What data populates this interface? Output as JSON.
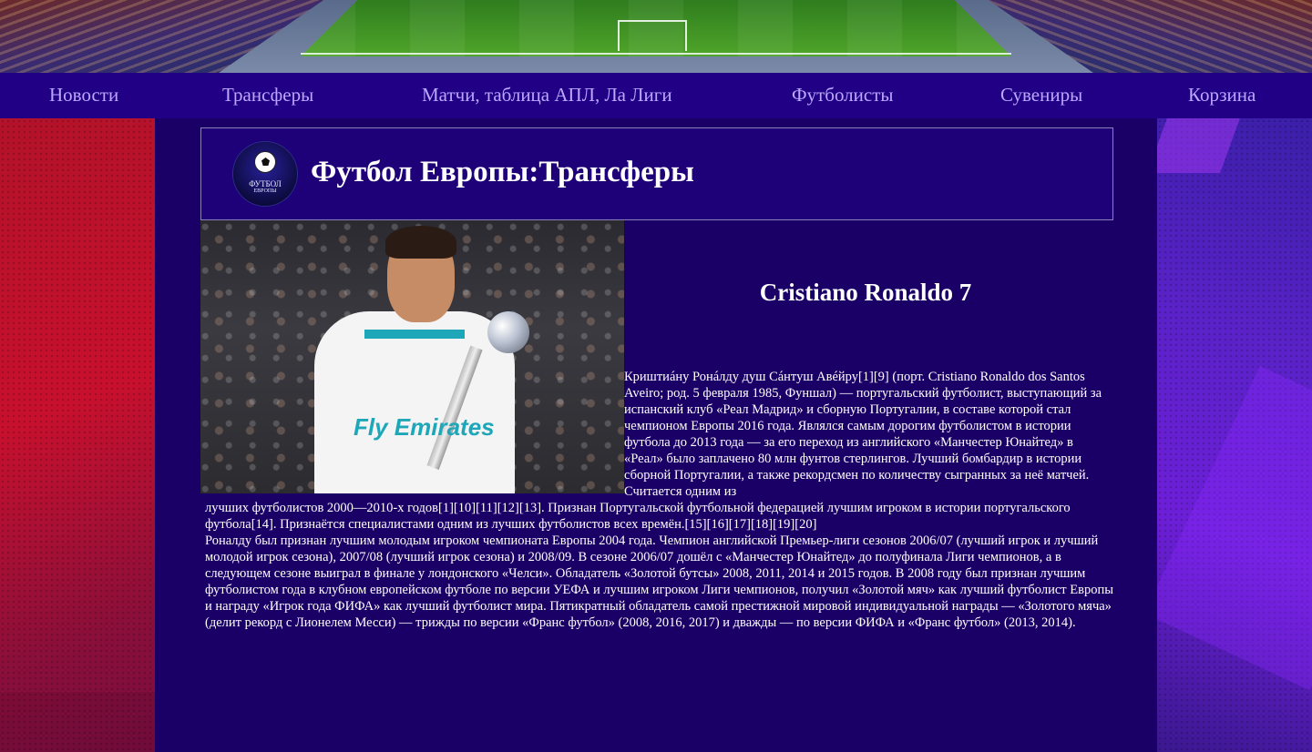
{
  "nav": {
    "items": [
      {
        "label": "Новости"
      },
      {
        "label": "Трансферы"
      },
      {
        "label": "Матчи, таблица АПЛ, Ла Лиги"
      },
      {
        "label": "Футболисты"
      },
      {
        "label": "Сувениры"
      },
      {
        "label": "Корзина"
      }
    ]
  },
  "header": {
    "logo_text_main": "ФУТБОЛ",
    "logo_text_sub": "ЕВРОПЫ",
    "title": "Футбол Европы:Трансферы"
  },
  "player": {
    "name": "Cristiano Ronaldo 7",
    "photo_sponsor": "Fly Emirates"
  },
  "article": {
    "lead": "Криштиáну Ронáлду душ Сáнтуш Авéйру[1][9] (порт. Cristiano Ronaldo dos Santos Aveiro; род. 5 февраля 1985, Фуншал) — португальский футболист, выступающий за испанский клуб «Реал Мадрид» и сборную Португалии, в составе которой стал чемпионом Европы 2016 года. Являлся самым дорогим футболистом в истории футбола до 2013 года — за его переход из английского «Манчестер Юнайтед» в «Реал» было заплачено 80 млн фунтов стерлингов. Лучший бомбардир в истории сборной Португалии, а также рекордсмен по количеству сыгранных за неё матчей. Считается одним из",
    "continuation": "лучших футболистов 2000—2010-х годов[1][10][11][12][13]. Признан Португальской футбольной федерацией лучшим игроком в истории португальского футбола[14]. Признаётся специалистами одним из лучших футболистов всех времён.[15][16][17][18][19][20]",
    "paragraph2": "Роналду был признан лучшим молодым игроком чемпионата Европы 2004 года. Чемпион английской Премьер-лиги сезонов 2006/07 (лучший игрок и лучший молодой игрок сезона), 2007/08 (лучший игрок сезона) и 2008/09. В сезоне 2006/07 дошёл с «Манчестер Юнайтед» до полуфинала Лиги чемпионов, а в следующем сезоне выиграл в финале у лондонского «Челси». Обладатель «Золотой бутсы» 2008, 2011, 2014 и 2015 годов. В 2008 году был признан лучшим футболистом года в клубном европейском футболе по версии УЕФА и лучшим игроком Лиги чемпионов, получил «Золотой мяч» как лучший футболист Европы и награду «Игрок года ФИФА» как лучший футболист мира. Пятикратный обладатель самой престижной мировой индивидуальной награды — «Золотого мяча» (делит рекорд с Лионелем Месси) — трижды по версии «Франс футбол» (2008, 2016, 2017) и дважды — по версии ФИФА и «Франс футбол» (2013, 2014)."
  },
  "colors": {
    "nav_bg": "#210085",
    "nav_link": "#b9a9ff",
    "page_bg": "#1a0066",
    "text": "#ffffff"
  }
}
